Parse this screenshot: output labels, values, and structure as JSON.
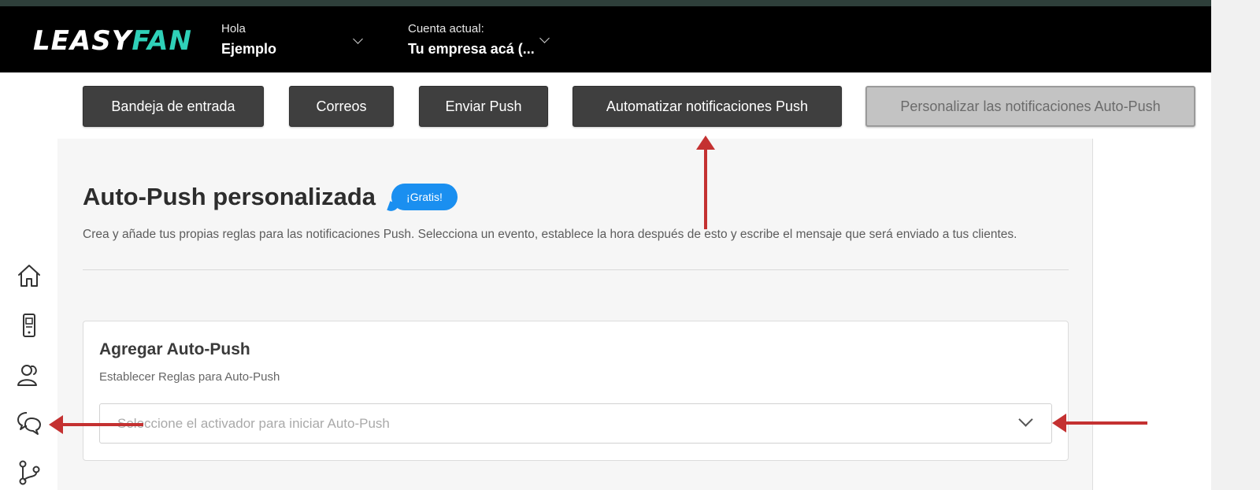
{
  "brand": {
    "logo_part1": "LEASY",
    "logo_part2": "FAN",
    "accent": "#2fd0b8"
  },
  "header": {
    "greeting_label": "Hola",
    "user_name": "Ejemplo",
    "account_label": "Cuenta actual:",
    "account_name": "Tu empresa acá (..."
  },
  "tabs": [
    {
      "label": "Bandeja de entrada",
      "active": false
    },
    {
      "label": "Correos",
      "active": false
    },
    {
      "label": "Enviar Push",
      "active": false
    },
    {
      "label": "Automatizar notificaciones Push",
      "active": false
    },
    {
      "label": "Personalizar las notificaciones Auto-Push",
      "active": true
    }
  ],
  "sidebar": {
    "icons": [
      "home-icon",
      "mobile-device-icon",
      "users-icon",
      "chat-icon",
      "workflow-icon"
    ]
  },
  "main": {
    "title": "Auto-Push personalizada",
    "badge": "¡Gratis!",
    "description": "Crea y añade tus propias reglas para las notificaciones Push. Selecciona un evento, establece la hora después de esto y escribe el mensaje que será enviado a tus clientes.",
    "card": {
      "title": "Agregar Auto-Push",
      "subtitle": "Establecer Reglas para Auto-Push",
      "select_placeholder": "Seleccione el activador para iniciar Auto-Push"
    }
  },
  "colors": {
    "header_bg": "#000000",
    "tab_bg": "#3f3f3f",
    "badge_bg": "#1a8ff0",
    "annotation_arrow": "#c43131"
  }
}
